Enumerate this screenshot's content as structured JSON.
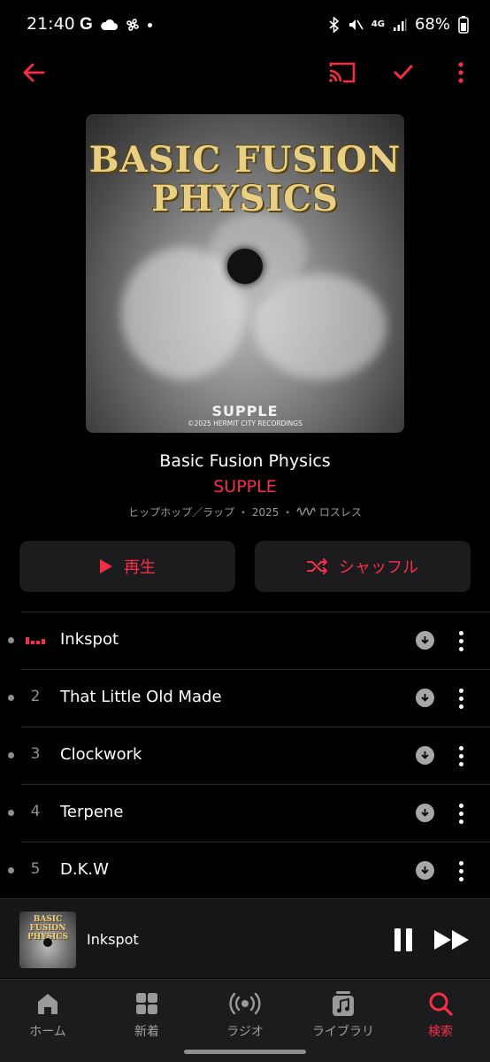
{
  "status_bar": {
    "time": "21:40",
    "network": "4G",
    "battery": "68%"
  },
  "toolbar": {
    "back": "back-arrow-icon",
    "cast": "cast-icon",
    "added": "checkmark-icon",
    "more": "more-vertical-icon"
  },
  "album": {
    "art_title": "BASIC FUSION PHYSICS",
    "art_brand": "SUPPLE",
    "art_copyright": "©2025 HERMIT CITY RECORDINGS",
    "title": "Basic Fusion Physics",
    "artist": "SUPPLE",
    "genre": "ヒップホップ／ラップ",
    "year": "2025",
    "lossless": "ロスレス"
  },
  "actions": {
    "play": "再生",
    "shuffle": "シャッフル"
  },
  "tracks": [
    {
      "number": "",
      "title": "Inkspot",
      "playing": true
    },
    {
      "number": "2",
      "title": "That Little Old Made",
      "playing": false
    },
    {
      "number": "3",
      "title": "Clockwork",
      "playing": false
    },
    {
      "number": "4",
      "title": "Terpene",
      "playing": false
    },
    {
      "number": "5",
      "title": "D.K.W",
      "playing": false
    }
  ],
  "mini_player": {
    "song": "Inkspot",
    "thumb_title": "BASIC FUSION PHYSICS"
  },
  "nav": [
    {
      "label": "ホーム",
      "icon": "home-icon"
    },
    {
      "label": "新着",
      "icon": "grid-icon"
    },
    {
      "label": "ラジオ",
      "icon": "radio-icon"
    },
    {
      "label": "ライブラリ",
      "icon": "library-icon"
    },
    {
      "label": "検索",
      "icon": "search-icon",
      "active": true
    }
  ],
  "colors": {
    "accent": "#fa2d48",
    "background": "#000000",
    "button_bg": "#1c1c1e"
  }
}
